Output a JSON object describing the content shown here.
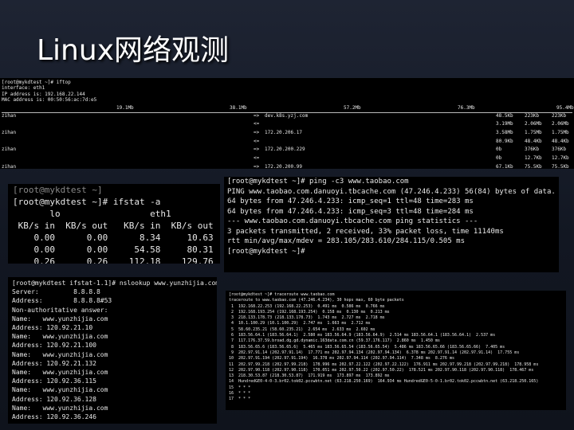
{
  "title": "Linux网络观测",
  "iftop": {
    "header": [
      "[root@mykdtest ~]# iftop",
      "interface: eth1",
      "IP address is: 192.168.22.144",
      "MAC address is: 00:50:56:ac:7d:e5"
    ],
    "scale": [
      "19.1Mb",
      "38.1Mb",
      "57.2Mb",
      "76.3Mb",
      "95.4Mb"
    ],
    "rows": [
      {
        "host": "zihan",
        "dir": "=>",
        "dest": "dev.k8s.yzj.com",
        "r1": "48.5Kb",
        "r2": "223Kb",
        "r3": "223Kb"
      },
      {
        "host": "",
        "dir": "<=",
        "dest": "",
        "r1": "3.19Mb",
        "r2": "2.06Mb",
        "r3": "2.06Mb"
      },
      {
        "host": "zihan",
        "dir": "=>",
        "dest": "172.20.206.17",
        "r1": "3.58Mb",
        "r2": "1.75Mb",
        "r3": "1.75Mb"
      },
      {
        "host": "",
        "dir": "<=",
        "dest": "",
        "r1": "80.9Kb",
        "r2": "48.4Kb",
        "r3": "48.4Kb"
      },
      {
        "host": "zihan",
        "dir": "=>",
        "dest": "172.20.200.229",
        "r1": "0b",
        "r2": "376Kb",
        "r3": "376Kb"
      },
      {
        "host": "",
        "dir": "<=",
        "dest": "",
        "r1": "0b",
        "r2": "12.7Kb",
        "r3": "12.7Kb"
      },
      {
        "host": "zihan",
        "dir": "=>",
        "dest": "172.20.200.99",
        "r1": "67.1Kb",
        "r2": "75.5Kb",
        "r3": "75.5Kb"
      },
      {
        "host": "",
        "dir": "<=",
        "dest": "",
        "r1": "12.8Kb",
        "r2": "29.9Kb",
        "r3": "29.9Kb"
      }
    ]
  },
  "ifstat": {
    "lines": [
      "[root@mykdtest ~]# ifstat -a",
      "       lo                 eth1",
      " KB/s in  KB/s out   KB/s in  KB/s out",
      "    0.00      0.00      8.34     10.63",
      "    0.00      0.00     54.58     80.31",
      "    0.26      0.26    112.18    129.76"
    ]
  },
  "ping": {
    "lines": [
      "[root@mykdtest ~]# ping -c3 www.taobao.com",
      "PING www.taobao.com.danuoyi.tbcache.com (47.246.4.233) 56(84) bytes of data.",
      "64 bytes from 47.246.4.233: icmp_seq=1 ttl=48 time=283 ms",
      "64 bytes from 47.246.4.233: icmp_seq=3 ttl=48 time=284 ms",
      "",
      "--- www.taobao.com.danuoyi.tbcache.com ping statistics ---",
      "3 packets transmitted, 2 received, 33% packet loss, time 11140ms",
      "rtt min/avg/max/mdev = 283.105/283.610/284.115/0.505 ms",
      "[root@mykdtest ~]# "
    ]
  },
  "nslookup": {
    "lines": [
      "[root@mykdtest ifstat-1.1]# nslookup www.yunzhijia.com",
      "Server:         8.8.8.8",
      "Address:        8.8.8.8#53",
      "",
      "Non-authoritative answer:",
      "Name:   www.yunzhijia.com",
      "Address: 120.92.21.10",
      "Name:   www.yunzhijia.com",
      "Address: 120.92.21.100",
      "Name:   www.yunzhijia.com",
      "Address: 120.92.21.132",
      "Name:   www.yunzhijia.com",
      "Address: 120.92.36.115",
      "Name:   www.yunzhijia.com",
      "Address: 120.92.36.128",
      "Name:   www.yunzhijia.com",
      "Address: 120.92.36.246"
    ]
  },
  "traceroute": {
    "lines": [
      "[root@mykdtest ~]# traceroute www.taobao.com",
      "traceroute to www.taobao.com (47.246.4.234), 30 hops max, 60 byte packets",
      " 1  192.168.22.253 (192.168.22.253)  0.491 ms  0.586 ms  0.766 ms",
      " 2  192.168.193.254 (192.168.193.254)  0.158 ms  0.130 ms  0.213 ms",
      " 3  218.133.178.73 (218.133.178.73)  1.743 ms  2.727 ms  2.718 ms",
      " 4  10.1.100.29 (10.1.100.29)  2.747 ms  1.663 ms  2.712 ms",
      " 5  58.60.235.21 (58.60.235.21)  2.654 ms  2.633 ms  2.602 ms",
      " 6  183.56.64.1 (183.56.64.1)  2.580 ms 183.56.64.9 (183.56.64.9)  2.514 ms 183.56.64.1 (183.56.64.1)  2.537 ms",
      " 7  117.176.37.59.broad.dg.gd.dynamic.163data.com.cn (59.37.176.117)  2.860 ms  1.450 ms",
      " 8  183.56.65.6 (183.56.65.6)  5.465 ms 183.56.65.54 (183.56.65.54)  5.486 ms 183.56.65.66 (183.56.65.66)  7.405 ms",
      " 9  202.97.91.14 (202.97.91.14)  17.771 ms 202.97.94.134 (202.97.94.134)  6.378 ms 202.97.91.14 (202.97.91.14)  17.755 ms",
      "10  202.97.91.194 (202.97.91.194)  16.378 ms 202.97.94.114 (202.97.94.114)  7.348 ms  8.276 ms",
      "11  202.97.99.218 (202.97.99.218)  178.996 ms 202.97.22.122 (202.97.22.122)  176.911 ms 202.97.99.218 (202.97.99.218)  178.958 ms",
      "12  202.97.90.118 (202.97.90.118)  170.051 ms 202.97.50.22 (202.97.50.22)  178.521 ms 202.97.90.118 (202.97.90.118)  178.467 ms",
      "13  218.30.53.87 (218.30.53.87)  171.919 ms  173.897 ms  173.892 ms",
      "14  HundredGE0-4-0-3.br02.tok02.pccwbtn.net (63.218.250.169)  164.934 ms HundredGE0-5-0-1.br02.tok02.pccwbtn.net (63.218.250.165)",
      "15  * * *",
      "16  * * *",
      "17  * * *"
    ]
  }
}
